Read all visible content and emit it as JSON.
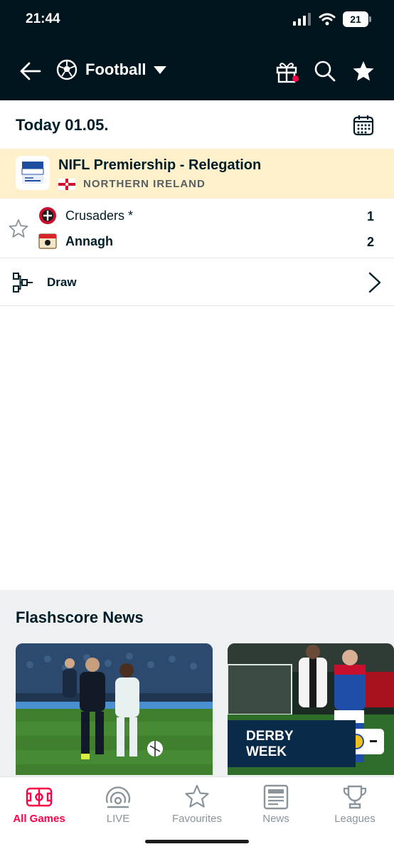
{
  "status_bar": {
    "time": "21:44",
    "battery": "21"
  },
  "header": {
    "sport": "Football"
  },
  "date_label": "Today 01.05.",
  "league": {
    "name": "NIFL Premiership - Relegation",
    "country": "NORTHERN IRELAND"
  },
  "match": {
    "home_team": "Crusaders *",
    "away_team": "Annagh",
    "home_score": "1",
    "away_score": "2"
  },
  "draw_label": "Draw",
  "news": {
    "title": "Flashscore News",
    "card2_banner_line1": "DERBY",
    "card2_banner_line2": "WEEK"
  },
  "tabs": [
    {
      "label": "All Games",
      "icon": "pitch-icon",
      "active": true
    },
    {
      "label": "LIVE",
      "icon": "live-icon"
    },
    {
      "label": "Favourites",
      "icon": "star-icon"
    },
    {
      "label": "News",
      "icon": "newspaper-icon"
    },
    {
      "label": "Leagues",
      "icon": "trophy-icon"
    }
  ],
  "colors": {
    "header_bg": "#00141e",
    "league_bg": "#fff0cc",
    "accent": "#ff0046",
    "news_bg": "#eef0f1"
  }
}
